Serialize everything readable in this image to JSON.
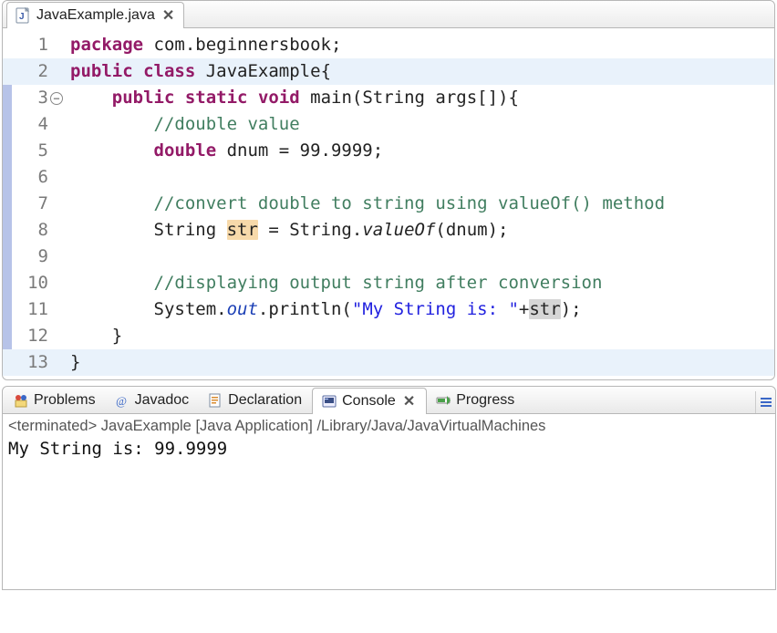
{
  "editor": {
    "tab": {
      "label": "JavaExample.java"
    },
    "lines": [
      {
        "n": "1",
        "marker": false
      },
      {
        "n": "2",
        "marker": false
      },
      {
        "n": "3",
        "marker": true,
        "fold": true
      },
      {
        "n": "4",
        "marker": true
      },
      {
        "n": "5",
        "marker": true
      },
      {
        "n": "6",
        "marker": true
      },
      {
        "n": "7",
        "marker": true
      },
      {
        "n": "8",
        "marker": true
      },
      {
        "n": "9",
        "marker": true
      },
      {
        "n": "10",
        "marker": true
      },
      {
        "n": "11",
        "marker": true
      },
      {
        "n": "12",
        "marker": true
      },
      {
        "n": "13",
        "marker": false
      }
    ],
    "code": {
      "l1": {
        "kw1": "package",
        "rest": " com.beginnersbook;"
      },
      "l2": {
        "kw1": "public",
        "kw2": "class",
        "rest": " JavaExample{"
      },
      "l3": {
        "indent": "    ",
        "kw1": "public",
        "kw2": "static",
        "kw3": "void",
        "rest": " main(String args[]){"
      },
      "l4": {
        "indent": "        ",
        "cmt": "//double value"
      },
      "l5": {
        "indent": "        ",
        "kw1": "double",
        "rest": " dnum = 99.9999;"
      },
      "l6": {
        "indent": ""
      },
      "l7": {
        "indent": "        ",
        "cmt": "//convert double to string using valueOf() method"
      },
      "l8": {
        "indent": "        ",
        "t1": "String ",
        "hl": "str",
        "t2": " = String.",
        "mth": "valueOf",
        "t3": "(dnum);"
      },
      "l9": {
        "indent": ""
      },
      "l10": {
        "indent": "        ",
        "cmt": "//displaying output string after conversion"
      },
      "l11": {
        "indent": "        ",
        "t1": "System.",
        "sta": "out",
        "t2": ".println(",
        "str": "\"My String is: \"",
        "t3": "+",
        "hl": "str",
        "t4": ");"
      },
      "l12": {
        "indent": "    ",
        "t1": "}"
      },
      "l13": {
        "t1": "}"
      }
    }
  },
  "bottom": {
    "tabs": {
      "problems": "Problems",
      "javadoc": "Javadoc",
      "declaration": "Declaration",
      "console": "Console",
      "progress": "Progress"
    },
    "console": {
      "status": "<terminated> JavaExample [Java Application] /Library/Java/JavaVirtualMachines",
      "output": "My String is: 99.9999"
    }
  }
}
